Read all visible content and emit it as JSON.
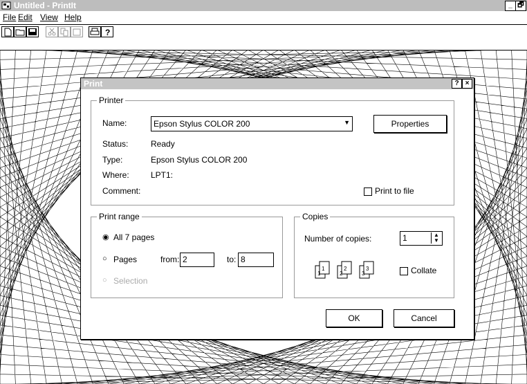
{
  "window": {
    "title": "Untitled - PrintIt",
    "minimize": "_",
    "restore": "🗗"
  },
  "menu": [
    "File",
    "Edit",
    "View",
    "Help"
  ],
  "toolbar_icons": [
    "new-icon",
    "open-icon",
    "save-icon",
    "cut-icon",
    "copy-icon",
    "paste-icon",
    "print-icon",
    "help-icon"
  ],
  "dialog": {
    "title": "Print",
    "help_btn": "?",
    "close_btn": "×",
    "printer_group": "Printer",
    "name_label": "Name:",
    "name_value": "Epson Stylus COLOR 200",
    "properties": "Properties",
    "status_label": "Status:",
    "status_value": "Ready",
    "type_label": "Type:",
    "type_value": "Epson Stylus COLOR 200",
    "where_label": "Where:",
    "where_value": "LPT1:",
    "comment_label": "Comment:",
    "print_to_file": "Print to file",
    "range_group": "Print range",
    "all_pages": "All 7 pages",
    "pages": "Pages",
    "from_label": "from:",
    "from_value": "2",
    "to_label": "to:",
    "to_value": "8",
    "selection": "Selection",
    "copies_group": "Copies",
    "num_copies_label": "Number of copies:",
    "num_copies_value": "1",
    "collate": "Collate",
    "ok": "OK",
    "cancel": "Cancel"
  }
}
